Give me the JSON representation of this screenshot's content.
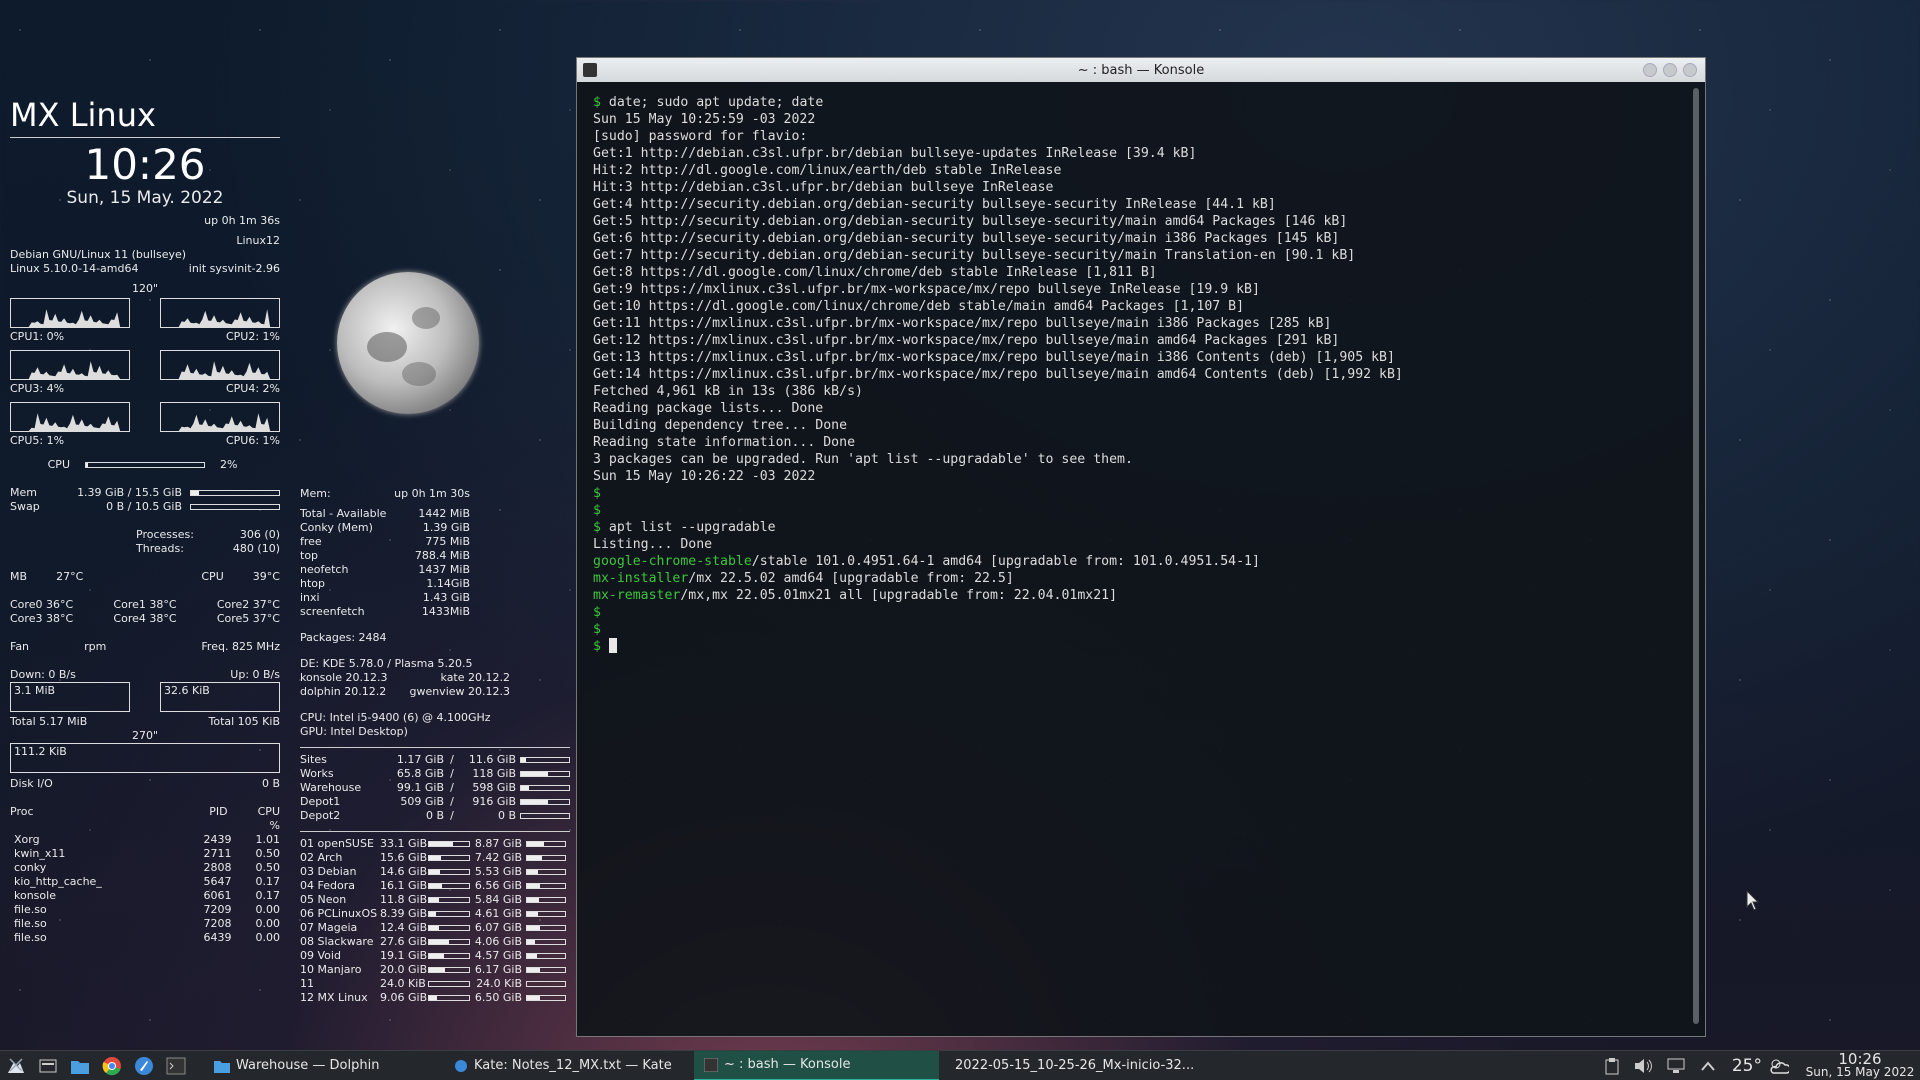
{
  "system": {
    "title": "MX Linux",
    "clock": "10:26",
    "date": "Sun, 15 May. 2022",
    "uptime": "up  0h 1m 36s",
    "hostname": "Linux12",
    "os": "Debian GNU/Linux 11 (bullseye)",
    "kernel": "Linux 5.10.0-14-amd64",
    "init": "init  sysvinit-2.96",
    "interval": "120\""
  },
  "cpus": [
    {
      "label": "CPU1: 0%"
    },
    {
      "label": "CPU2: 1%"
    },
    {
      "label": "CPU3: 4%"
    },
    {
      "label": "CPU4: 2%"
    },
    {
      "label": "CPU5: 1%"
    },
    {
      "label": "CPU6: 1%"
    }
  ],
  "cpu_total": {
    "label": "CPU",
    "value": "2%",
    "fill": 0.02
  },
  "memory": {
    "mem_label": "Mem",
    "mem_value": "1.39 GiB / 15.5 GiB",
    "mem_fill": 0.09,
    "swap_label": "Swap",
    "swap_value": "0 B / 10.5 GiB",
    "swap_fill": 0.0
  },
  "processes": {
    "proc_label": "Processes:",
    "proc_value": "306 (0)",
    "threads_label": "Threads:",
    "threads_value": "480 (10)"
  },
  "temps": {
    "mb": "MB",
    "mb_temp": "27°C",
    "cpu": "CPU",
    "cpu_temp": "39°C",
    "core0": "Core0  36°C",
    "core1": "Core1  38°C",
    "core2": "Core2  37°C",
    "core3": "Core3  38°C",
    "core4": "Core4  38°C",
    "core5": "Core5  37°C",
    "fan": "Fan",
    "rpm": "rpm",
    "freq": "Freq.  825    MHz"
  },
  "network": {
    "down": "Down: 0 B/s",
    "up": "Up: 0 B/s",
    "down_graph": "3.1 MiB",
    "up_graph": "32.6 KiB",
    "total_down": "Total 5.17 MiB",
    "total_up": "Total 105 KiB",
    "interval": "270\"",
    "disk_graph": "111.2 KiB",
    "disk_label": "Disk I/O",
    "disk_value": "0 B"
  },
  "proc_table": {
    "header_proc": "Proc",
    "header_pid": "PID",
    "header_cpu": "CPU",
    "header_pct": "%",
    "rows": [
      {
        "name": "Xorg",
        "pid": "2439",
        "cpu": "1.01"
      },
      {
        "name": "kwin_x11",
        "pid": "2711",
        "cpu": "0.50"
      },
      {
        "name": "conky",
        "pid": "2808",
        "cpu": "0.50"
      },
      {
        "name": "kio_http_cache_",
        "pid": "5647",
        "cpu": "0.17"
      },
      {
        "name": "konsole",
        "pid": "6061",
        "cpu": "0.17"
      },
      {
        "name": "file.so",
        "pid": "7209",
        "cpu": "0.00"
      },
      {
        "name": "file.so",
        "pid": "7208",
        "cpu": "0.00"
      },
      {
        "name": "file.so",
        "pid": "6439",
        "cpu": "0.00"
      }
    ]
  },
  "mem_panel": {
    "header": "Mem:",
    "uptime": "up  0h 1m 30s",
    "rows": [
      {
        "name": "Total - Available",
        "value": "1442 MiB"
      },
      {
        "name": "Conky (Mem)",
        "value": "1.39 GiB"
      },
      {
        "name": "free",
        "value": "775   MiB"
      },
      {
        "name": "top",
        "value": "788.4   MiB"
      },
      {
        "name": "neofetch",
        "value": "1437 MiB"
      },
      {
        "name": "htop",
        "value": "1.14GiB"
      },
      {
        "name": "inxi",
        "value": "1.43 GiB"
      },
      {
        "name": "screenfetch",
        "value": "1433MiB"
      }
    ],
    "packages": "Packages: 2484",
    "de": "DE: KDE 5.78.0 / Plasma 5.20.5",
    "apps": [
      {
        "a": "konsole 20.12.3",
        "b": "kate 20.12.2"
      },
      {
        "a": "dolphin 20.12.2",
        "b": "gwenview 20.12.3"
      }
    ],
    "cpu": "CPU: Intel i5-9400 (6) @ 4.100GHz",
    "gpu": "GPU: Intel Desktop)"
  },
  "drives": [
    {
      "name": "Sites",
      "used": "1.17 GiB",
      "sep": "/",
      "total": "11.6 GiB",
      "fill": 0.1
    },
    {
      "name": "Works",
      "used": "65.8 GiB",
      "sep": "/",
      "total": "118 GiB",
      "fill": 0.56
    },
    {
      "name": "Warehouse",
      "used": "99.1 GiB",
      "sep": "/",
      "total": "598 GiB",
      "fill": 0.17
    },
    {
      "name": "Depot1",
      "used": "509 GiB",
      "sep": "/",
      "total": "916 GiB",
      "fill": 0.56
    },
    {
      "name": "Depot2",
      "used": "0 B",
      "sep": "/",
      "total": "0 B",
      "fill": 0.0
    }
  ],
  "partitions": [
    {
      "name": "01 openSUSE",
      "used": "33.1 GiB",
      "u": 0.6,
      "free": "8.87 GiB",
      "f": 0.45
    },
    {
      "name": "02 Arch",
      "used": "15.6 GiB",
      "u": 0.3,
      "free": "7.42 GiB",
      "f": 0.4
    },
    {
      "name": "03 Debian",
      "used": "14.6 GiB",
      "u": 0.28,
      "free": "5.53 GiB",
      "f": 0.3
    },
    {
      "name": "04 Fedora",
      "used": "16.1 GiB",
      "u": 0.32,
      "free": "6.56 GiB",
      "f": 0.35
    },
    {
      "name": "05 Neon",
      "used": "11.8 GiB",
      "u": 0.24,
      "free": "5.84 GiB",
      "f": 0.32
    },
    {
      "name": "06 PCLinuxOS",
      "used": "8.39 GiB",
      "u": 0.18,
      "free": "4.61 GiB",
      "f": 0.28
    },
    {
      "name": "07 Mageia",
      "used": "12.4 GiB",
      "u": 0.25,
      "free": "6.07 GiB",
      "f": 0.33
    },
    {
      "name": "08 Slackware",
      "used": "27.6 GiB",
      "u": 0.5,
      "free": "4.06 GiB",
      "f": 0.22
    },
    {
      "name": "09 Void",
      "used": "19.1 GiB",
      "u": 0.38,
      "free": "4.57 GiB",
      "f": 0.25
    },
    {
      "name": "10 Manjaro",
      "used": "20.0 GiB",
      "u": 0.4,
      "free": "6.17 GiB",
      "f": 0.34
    },
    {
      "name": "11",
      "used": "24.0 KiB",
      "u": 0.0,
      "free": "24.0 KiB",
      "f": 0.0
    },
    {
      "name": "12 MX Linux",
      "used": "9.06 GiB",
      "u": 0.2,
      "free": "6.50 GiB",
      "f": 0.35
    }
  ],
  "konsole": {
    "title": "~ : bash — Konsole",
    "lines": [
      {
        "t": "$ date; sudo apt update; date"
      },
      {
        "t": "Sun 15 May 10:25:59 -03 2022"
      },
      {
        "t": "[sudo] password for flavio:"
      },
      {
        "t": "Get:1 http://debian.c3sl.ufpr.br/debian bullseye-updates InRelease [39.4 kB]"
      },
      {
        "t": "Hit:2 http://dl.google.com/linux/earth/deb stable InRelease"
      },
      {
        "t": "Hit:3 http://debian.c3sl.ufpr.br/debian bullseye InRelease"
      },
      {
        "t": "Get:4 http://security.debian.org/debian-security bullseye-security InRelease [44.1 kB]"
      },
      {
        "t": "Get:5 http://security.debian.org/debian-security bullseye-security/main amd64 Packages [146 kB]"
      },
      {
        "t": "Get:6 http://security.debian.org/debian-security bullseye-security/main i386 Packages [145 kB]"
      },
      {
        "t": "Get:7 http://security.debian.org/debian-security bullseye-security/main Translation-en [90.1 kB]"
      },
      {
        "t": "Get:8 https://dl.google.com/linux/chrome/deb stable InRelease [1,811 B]"
      },
      {
        "t": "Get:9 https://mxlinux.c3sl.ufpr.br/mx-workspace/mx/repo bullseye InRelease [19.9 kB]"
      },
      {
        "t": "Get:10 https://dl.google.com/linux/chrome/deb stable/main amd64 Packages [1,107 B]"
      },
      {
        "t": "Get:11 https://mxlinux.c3sl.ufpr.br/mx-workspace/mx/repo bullseye/main i386 Packages [285 kB]"
      },
      {
        "t": "Get:12 https://mxlinux.c3sl.ufpr.br/mx-workspace/mx/repo bullseye/main amd64 Packages [291 kB]"
      },
      {
        "t": "Get:13 https://mxlinux.c3sl.ufpr.br/mx-workspace/mx/repo bullseye/main i386 Contents (deb) [1,905 kB]"
      },
      {
        "t": "Get:14 https://mxlinux.c3sl.ufpr.br/mx-workspace/mx/repo bullseye/main amd64 Contents (deb) [1,992 kB]"
      },
      {
        "t": "Fetched 4,961 kB in 13s (386 kB/s)"
      },
      {
        "t": "Reading package lists... Done"
      },
      {
        "t": "Building dependency tree... Done"
      },
      {
        "t": "Reading state information... Done"
      },
      {
        "t": "3 packages can be upgraded. Run 'apt list --upgradable' to see them."
      },
      {
        "t": "Sun 15 May 10:26:22 -03 2022"
      },
      {
        "t": "$"
      },
      {
        "t": "$"
      },
      {
        "t": "$ apt list --upgradable"
      },
      {
        "t": "Listing... Done"
      },
      {
        "g": "google-chrome-stable",
        "t": "/stable 101.0.4951.64-1 amd64 [upgradable from: 101.0.4951.54-1]"
      },
      {
        "g": "mx-installer",
        "t": "/mx 22.5.02 amd64 [upgradable from: 22.5]"
      },
      {
        "g": "mx-remaster",
        "t": "/mx,mx 22.05.01mx21 all [upgradable from: 22.04.01mx21]"
      },
      {
        "t": "$"
      },
      {
        "t": "$"
      },
      {
        "t": "$ ",
        "cursor": true
      }
    ]
  },
  "taskbar": {
    "tasks": [
      {
        "label": "Warehouse — Dolphin"
      },
      {
        "label": "Kate: Notes_12_MX.txt  — Kate"
      },
      {
        "label": "~ : bash — Konsole"
      },
      {
        "label": "2022-05-15_10-25-26_Mx-inicio-32..."
      }
    ],
    "weather": "25°",
    "clock": "10:26",
    "date": "Sun, 15 May 2022"
  }
}
